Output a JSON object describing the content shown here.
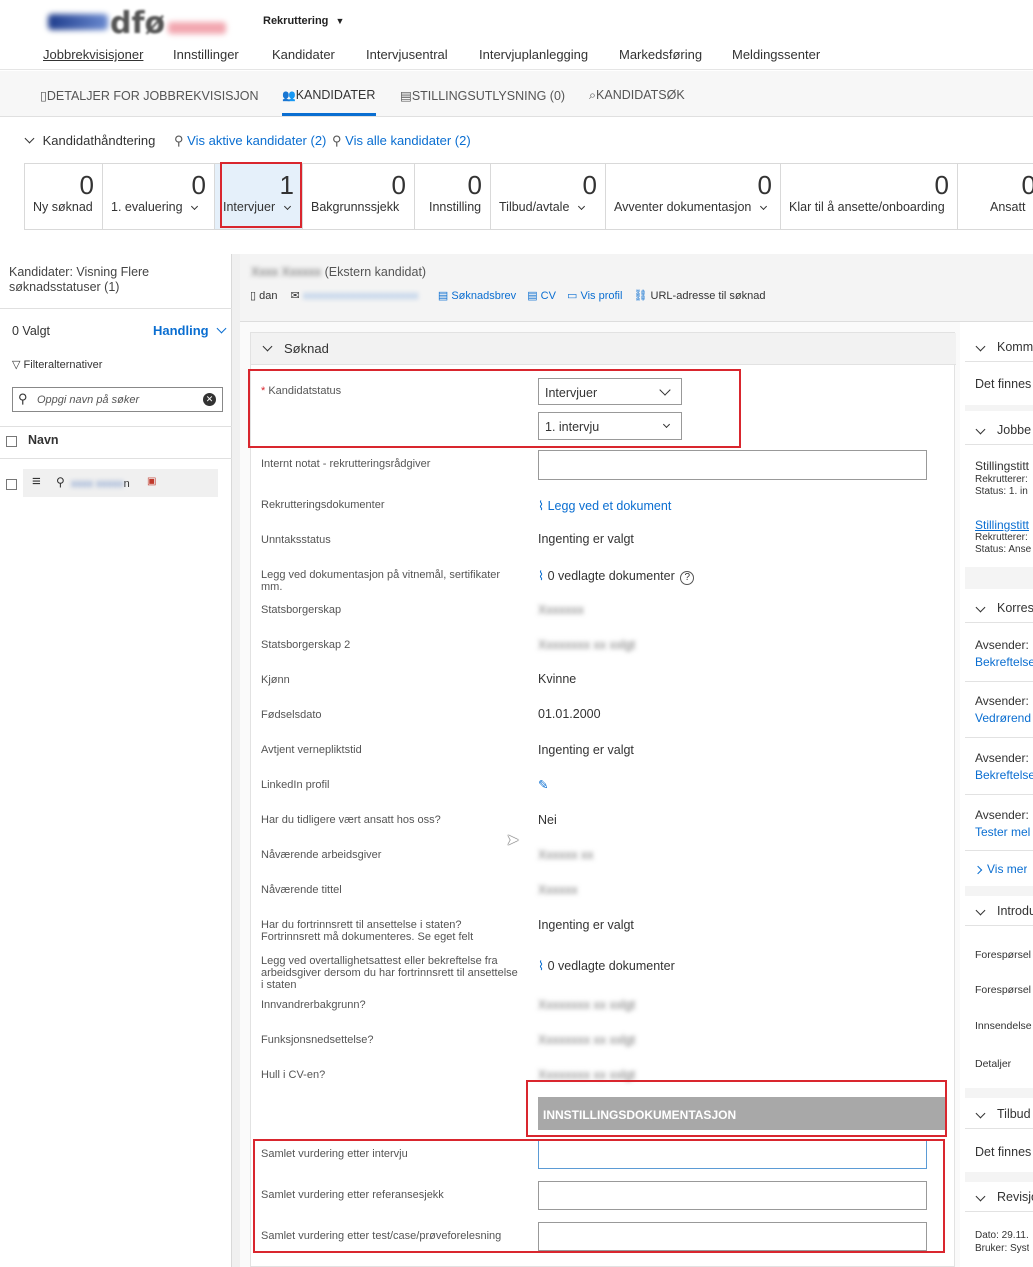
{
  "header": {
    "module_label": "Rekruttering",
    "nav": [
      "Jobbrekvisisjoner",
      "Innstillinger",
      "Kandidater",
      "Intervjusentral",
      "Intervjuplanlegging",
      "Markedsføring",
      "Meldingssenter"
    ]
  },
  "tabs": [
    {
      "label": "DETALJER FOR JOBBREKVISISJON",
      "icon": "document-icon"
    },
    {
      "label": "KANDIDATER",
      "icon": "people-icon"
    },
    {
      "label": "STILLINGSUTLYSNING (0)",
      "icon": "posting-icon"
    },
    {
      "label": "KANDIDATSØK",
      "icon": "search-icon"
    }
  ],
  "candidate_mgmt": {
    "title": "Kandidathåndtering",
    "active_link": "Vis aktive kandidater (2)",
    "all_link": "Vis alle kandidater (2)"
  },
  "status_cells": [
    {
      "count": "0",
      "label": "Ny søknad"
    },
    {
      "count": "0",
      "label": "1. evaluering"
    },
    {
      "count": "1",
      "label": "Intervjuer"
    },
    {
      "count": "0",
      "label": "Bakgrunnssjekk"
    },
    {
      "count": "0",
      "label": "Innstilling"
    },
    {
      "count": "0",
      "label": "Tilbud/avtale"
    },
    {
      "count": "0",
      "label": "Avventer dokumentasjon"
    },
    {
      "count": "0",
      "label": "Klar til å ansette/onboarding"
    },
    {
      "count": "0",
      "label": "Ansatt"
    }
  ],
  "left_panel": {
    "title": "Kandidater: Visning Flere søknadsstatuser (1)",
    "selected": "0 Valgt",
    "action": "Handling",
    "filter": "Filteralternativer",
    "search_placeholder": "Oppgi navn på søker",
    "col_name": "Navn",
    "row_suffix": "n"
  },
  "candidate": {
    "type": "(Ekstern kandidat)",
    "lang": "dan",
    "links": [
      "Søknadsbrev",
      "CV",
      "Vis profil",
      "URL-adresse til søknad"
    ]
  },
  "form": {
    "section": "Søknad",
    "status_label": "Kandidatstatus",
    "status_value": "Intervjuer",
    "substatus_value": "1. intervju",
    "fields": [
      {
        "label": "Internt notat - rekrutteringsrådgiver"
      },
      {
        "label": "Rekrutteringsdokumenter",
        "value": "Legg ved et dokument"
      },
      {
        "label": "Unntaksstatus",
        "value": "Ingenting er valgt"
      },
      {
        "label": "Legg ved dokumentasjon på vitnemål, sertifikater mm.",
        "value": "0 vedlagte dokumenter"
      },
      {
        "label": "Statsborgerskap"
      },
      {
        "label": "Statsborgerskap 2"
      },
      {
        "label": "Kjønn",
        "value": "Kvinne"
      },
      {
        "label": "Fødselsdato",
        "value": "01.01.2000"
      },
      {
        "label": "Avtjent vernepliktstid",
        "value": "Ingenting er valgt"
      },
      {
        "label": "LinkedIn profil"
      },
      {
        "label": "Har du tidligere vært ansatt hos oss?",
        "value": "Nei"
      },
      {
        "label": "Nåværende arbeidsgiver"
      },
      {
        "label": "Nåværende tittel"
      },
      {
        "label": "Har du fortrinnsrett til ansettelse i staten? Fortrinnsrett må dokumenteres. Se eget felt",
        "value": "Ingenting er valgt"
      },
      {
        "label": "Legg ved overtallighetsattest eller bekreftelse fra arbeidsgiver dersom du har fortrinnsrett til ansettelse i staten",
        "value": "0 vedlagte dokumenter"
      },
      {
        "label": "Innvandrerbakgrunn?"
      },
      {
        "label": "Funksjonsnedsettelse?"
      },
      {
        "label": "Hull i CV-en?"
      }
    ],
    "section_band": "INNSTILLINGSDOKUMENTASJON",
    "eval_fields": [
      "Samlet vurdering etter intervju",
      "Samlet vurdering etter referansesjekk",
      "Samlet vurdering etter test/case/prøveforelesning"
    ]
  },
  "right_col": {
    "sections": [
      "Komm",
      "Jobbe",
      "Korres",
      "Introdu",
      "Tilbud",
      "Revisjo"
    ],
    "komm_text": "Det finnes",
    "jobbe": [
      {
        "title": "Stillingstitt",
        "l1": "Rekrutterer:",
        "l2": "Status: 1. in"
      },
      {
        "title": "Stillingstitt",
        "l1": "Rekrutterer:",
        "l2": "Status: Anse"
      }
    ],
    "korres": [
      {
        "from": "Avsender:",
        "link": "Bekreftelse"
      },
      {
        "from": "Avsender:",
        "link": "Vedrørend"
      },
      {
        "from": "Avsender:",
        "link": "Bekreftelse"
      },
      {
        "from": "Avsender:",
        "link": "Tester mel"
      }
    ],
    "more": "Vis mer",
    "introdu": [
      "Forespørsel",
      "Forespørsel",
      "Innsendelse",
      "Detaljer"
    ],
    "tilbud_text": "Det finnes",
    "revisjo": [
      "Dato: 29.11.",
      "Bruker: Syst"
    ]
  },
  "colors": {
    "accent": "#0a6ed1",
    "highlight": "#d9262e",
    "band": "#a8a8a8"
  }
}
